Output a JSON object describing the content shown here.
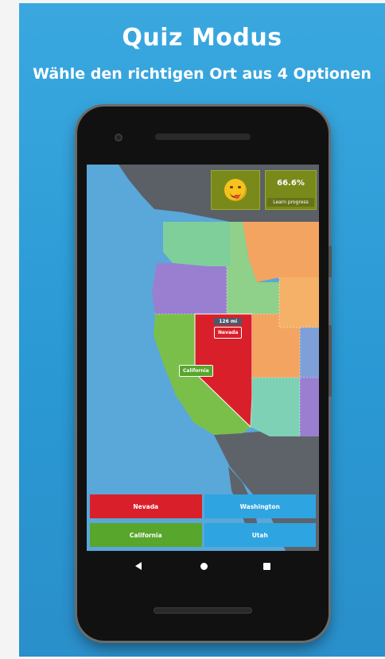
{
  "promo": {
    "title": "Quiz Modus",
    "subtitle": "Wähle den richtigen Ort aus 4 Optionen"
  },
  "hud": {
    "emoji_icon": "grinning-tongue-emoji",
    "progress_value": "66.6%",
    "progress_label": "Learn progress"
  },
  "map": {
    "highlight_pin": {
      "distance": "126 mi",
      "name": "Nevada"
    },
    "answer_pin": {
      "name": "California"
    }
  },
  "answers": [
    {
      "label": "Nevada",
      "color": "#d9202a"
    },
    {
      "label": "Washington",
      "color": "#2ea4e0"
    },
    {
      "label": "California",
      "color": "#58a62c"
    },
    {
      "label": "Utah",
      "color": "#2ea4e0"
    }
  ],
  "navbar": {
    "back_icon": "back-triangle-icon",
    "home_icon": "home-circle-icon",
    "recents_icon": "recents-square-icon"
  }
}
